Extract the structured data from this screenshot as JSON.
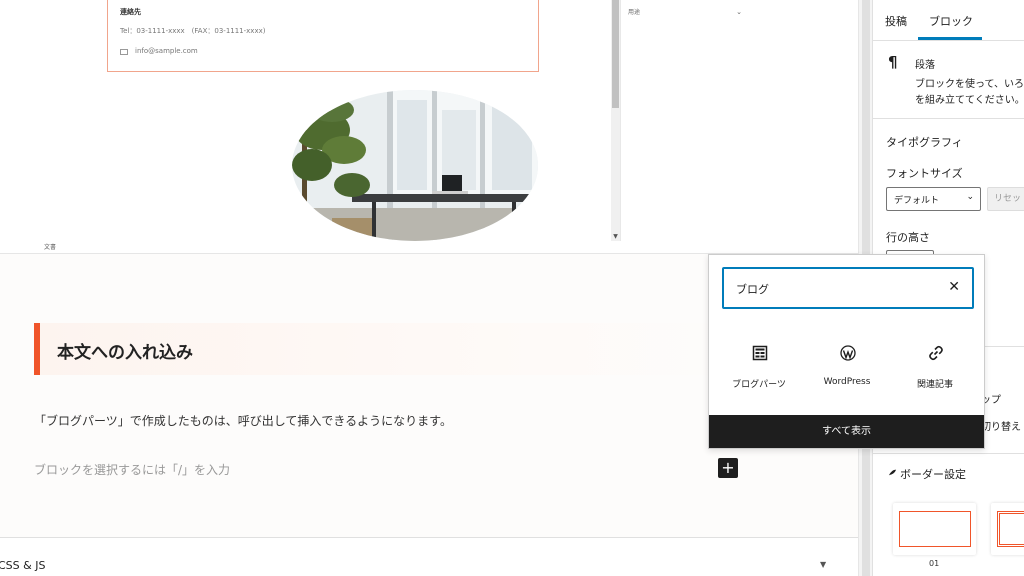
{
  "editor": {
    "contact": {
      "heading": "連絡先",
      "tel": "Tel：03-1111-xxxx　(FAX：03-1111-xxxx)",
      "email": "info@sample.com"
    },
    "side_panel_label": "用途",
    "doc_label": "文書",
    "heading_block": "本文への入れ込み",
    "paragraph": "「ブログパーツ」で作成したものは、呼び出して挿入できるようになります。",
    "placeholder": "ブロックを選択するには「/」を入力",
    "add_block": "+",
    "css_js_panel": "CSS & JS"
  },
  "inserter": {
    "search_value": "ブログ",
    "clear_icon": "close-icon",
    "results": [
      {
        "label": "ブログパーツ",
        "icon": "blog-parts-icon"
      },
      {
        "label": "WordPress",
        "icon": "wordpress-icon"
      },
      {
        "label": "関連記事",
        "icon": "link-icon"
      }
    ],
    "show_all": "すべて表示"
  },
  "sidebar": {
    "tabs": [
      {
        "label": "投稿",
        "active": false
      },
      {
        "label": "ブロック",
        "active": true
      }
    ],
    "block": {
      "icon": "¶",
      "title": "段落",
      "description_line1": "ブロックを使って、いろ",
      "description_line2": "を組み立ててください。"
    },
    "typography": {
      "title": "タイポグラフィ",
      "font_size_label": "フォントサイズ",
      "font_size_value": "デフォルト",
      "reset_label": "リセット",
      "line_height_label": "行の高さ"
    },
    "partial_text_1": "ップ",
    "partial_text_2": "切り替え",
    "border": {
      "title": "ボーダー設定",
      "option_label": "01"
    }
  },
  "colors": {
    "accent": "#f0552a",
    "focus": "#007cba",
    "dark": "#1e1e1e"
  }
}
